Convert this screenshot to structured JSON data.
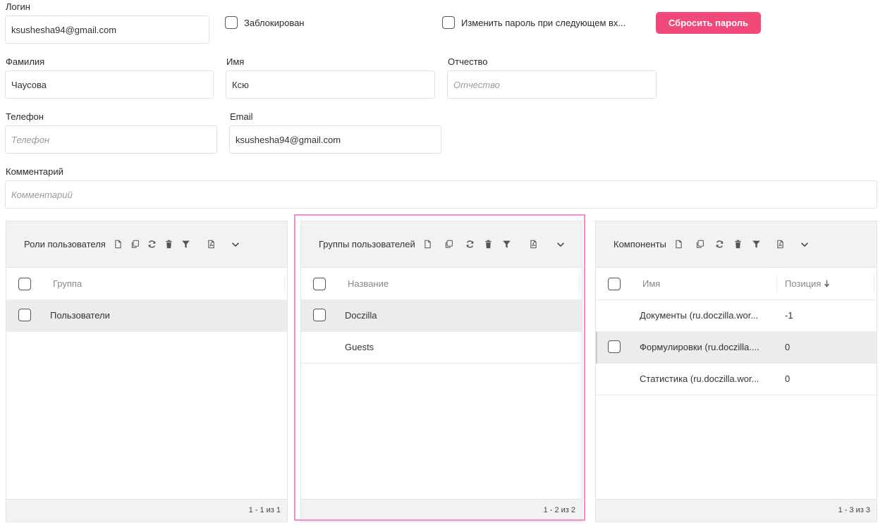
{
  "form": {
    "login_label": "Логин",
    "login_value": "ksushesha94@gmail.com",
    "blocked_label": "Заблокирован",
    "change_password_label": "Изменить пароль при следующем вх...",
    "reset_password_button": "Сбросить пароль",
    "lastname_label": "Фамилия",
    "lastname_value": "Чаусова",
    "firstname_label": "Имя",
    "firstname_value": "Ксю",
    "middlename_label": "Отчество",
    "middlename_placeholder": "Отчество",
    "phone_label": "Телефон",
    "phone_placeholder": "Телефон",
    "email_label": "Email",
    "email_value": "ksushesha94@gmail.com",
    "comment_label": "Комментарий",
    "comment_placeholder": "Комментарий"
  },
  "roles_panel": {
    "title": "Роли пользователя",
    "column": "Группа",
    "rows": [
      {
        "name": "Пользователи",
        "selected": true
      }
    ],
    "footer": "1 - 1 из 1"
  },
  "groups_panel": {
    "title": "Группы пользователей",
    "column": "Название",
    "rows": [
      {
        "name": "Doczilla",
        "selected": true
      },
      {
        "name": "Guests",
        "selected": false
      }
    ],
    "footer": "1 - 2 из 2"
  },
  "components_panel": {
    "title": "Компоненты",
    "column_name": "Имя",
    "column_position": "Позиция",
    "rows": [
      {
        "name": "Документы (ru.doczilla.wor...",
        "position": "-1",
        "selected": false
      },
      {
        "name": "Формулировки (ru.doczilla....",
        "position": "0",
        "selected": true
      },
      {
        "name": "Статистика (ru.doczilla.wor...",
        "position": "0",
        "selected": false
      }
    ],
    "footer": "1 - 3 из 3"
  },
  "colors": {
    "accent": "#f0497a",
    "highlight": "#ef8fc3",
    "header_bg": "#f2f2f2",
    "selected_row_bg": "#ececec"
  },
  "icons": [
    "new-document-icon",
    "copy-icon",
    "refresh-icon",
    "delete-icon",
    "filter-icon",
    "pdf-icon",
    "chevron-down-icon",
    "sort-descending-icon"
  ]
}
